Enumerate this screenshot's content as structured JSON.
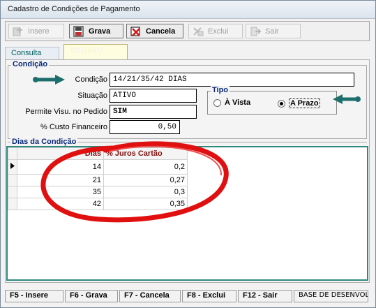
{
  "window": {
    "title": "Cadastro de Condições de Pagamento"
  },
  "toolbar": {
    "buttons": [
      {
        "label": "Insere",
        "icon": "insert-icon",
        "enabled": false
      },
      {
        "label": "Grava",
        "icon": "save-icon",
        "enabled": true
      },
      {
        "label": "Cancela",
        "icon": "cancel-icon",
        "enabled": true
      },
      {
        "label": "Exclui",
        "icon": "delete-icon",
        "enabled": false
      },
      {
        "label": "Sair",
        "icon": "exit-icon",
        "enabled": false
      }
    ]
  },
  "tabs": [
    {
      "label": "Consulta",
      "active": false
    },
    {
      "label": "Cadastro",
      "active": true
    }
  ],
  "condicao": {
    "legend": "Condição",
    "condicao_label": "Condição",
    "condicao_value": "14/21/35/42 DIAS",
    "situacao_label": "Situação",
    "situacao_value": "ATIVO",
    "visu_label": "Permite Visu. no Pedido",
    "visu_value": "SIM",
    "custo_label": "% Custo Financeiro",
    "custo_value": "0,50"
  },
  "tipo": {
    "legend": "Tipo",
    "options": [
      {
        "label": "À Vista",
        "selected": false
      },
      {
        "label": "A Prazo",
        "selected": true
      }
    ]
  },
  "dias": {
    "legend": "Dias da Condição",
    "columns": [
      "Dias",
      "% Juros Cartão"
    ],
    "rows": [
      {
        "dias": "14",
        "juros": "0,2"
      },
      {
        "dias": "21",
        "juros": "0,27"
      },
      {
        "dias": "35",
        "juros": "0,3"
      },
      {
        "dias": "42",
        "juros": "0,35"
      }
    ]
  },
  "statusbar": {
    "items": [
      "F5 - Insere",
      "F6 - Grava",
      "F7 - Cancela",
      "F8 - Exclui",
      "F12 - Sair"
    ],
    "base": "BASE DE DESENVOL"
  },
  "colors": {
    "annotation_red": "#e01010",
    "arrow_teal": "#1e6e6e",
    "legend_blue": "#0a2a7a",
    "grid_border": "#2f8a7e"
  }
}
